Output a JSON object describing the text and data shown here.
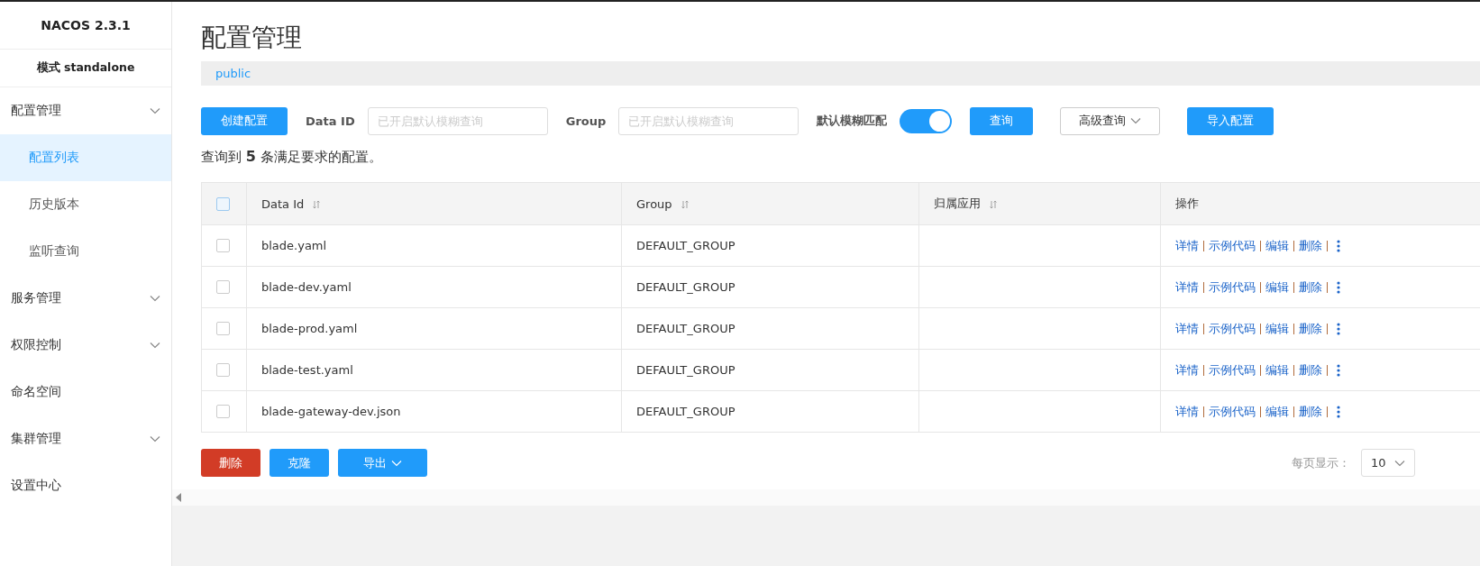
{
  "sidebar": {
    "title": "NACOS 2.3.1",
    "mode": "模式 standalone",
    "items": [
      {
        "kind": "group",
        "label": "配置管理",
        "children": [
          {
            "label": "配置列表",
            "selected": true
          },
          {
            "label": "历史版本",
            "selected": false
          },
          {
            "label": "监听查询",
            "selected": false
          }
        ]
      },
      {
        "kind": "group",
        "label": "服务管理"
      },
      {
        "kind": "group",
        "label": "权限控制"
      },
      {
        "kind": "link",
        "label": "命名空间"
      },
      {
        "kind": "group",
        "label": "集群管理"
      },
      {
        "kind": "link",
        "label": "设置中心"
      }
    ]
  },
  "page_title": "配置管理",
  "namespace": "public",
  "toolbar": {
    "create_button": "创建配置",
    "data_id_label": "Data ID",
    "data_id_placeholder": "已开启默认模糊查询",
    "group_label": "Group",
    "group_placeholder": "已开启默认模糊查询",
    "fuzzy_label": "默认模糊匹配",
    "fuzzy_on": true,
    "search_button": "查询",
    "advanced_button": "高级查询",
    "import_button": "导入配置"
  },
  "result_summary": "查询到 **5** 条满足要求的配置。",
  "table": {
    "select_all_checked": false,
    "columns": [
      {
        "label": "Data Id",
        "sortable": true
      },
      {
        "label": "Group",
        "sortable": true
      },
      {
        "label": "归属应用",
        "sortable": true
      },
      {
        "label": "操作",
        "sortable": false
      }
    ],
    "rows": [
      {
        "checked": false,
        "data_id": "blade.yaml",
        "group": "DEFAULT_GROUP",
        "actions": [
          "详情",
          "示例代码",
          "编辑",
          "删除"
        ]
      },
      {
        "checked": false,
        "data_id": "blade-dev.yaml",
        "group": "DEFAULT_GROUP",
        "actions": [
          "详情",
          "示例代码",
          "编辑",
          "删除"
        ]
      },
      {
        "checked": false,
        "data_id": "blade-prod.yaml",
        "group": "DEFAULT_GROUP",
        "actions": [
          "详情",
          "示例代码",
          "编辑",
          "删除"
        ]
      },
      {
        "checked": false,
        "data_id": "blade-test.yaml",
        "group": "DEFAULT_GROUP",
        "actions": [
          "详情",
          "示例代码",
          "编辑",
          "删除"
        ]
      },
      {
        "checked": false,
        "data_id": "blade-gateway-dev.json",
        "group": "DEFAULT_GROUP",
        "actions": [
          "详情",
          "示例代码",
          "编辑",
          "删除"
        ]
      }
    ]
  },
  "bulk_buttons": [
    {
      "kind": "danger",
      "label": "删除"
    },
    {
      "kind": "primary",
      "label": "克隆"
    },
    {
      "kind": "dropdown",
      "label": "导出"
    }
  ],
  "pagination": {
    "page_size_label": "每页显示：",
    "page_size": "10"
  }
}
